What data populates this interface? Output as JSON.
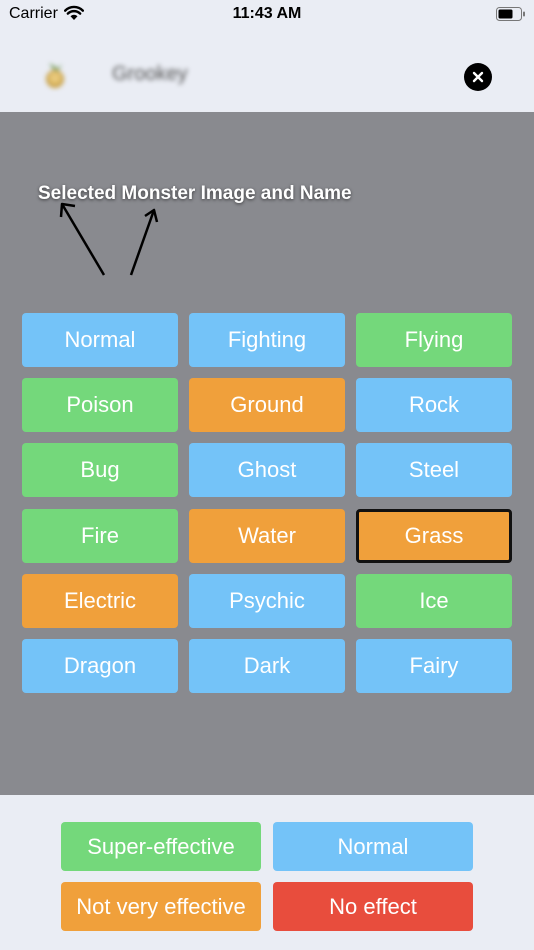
{
  "status_bar": {
    "carrier": "Carrier",
    "time": "11:43 AM"
  },
  "header": {
    "monster_name": "Grookey",
    "close_icon": "close-icon"
  },
  "annotation": "Selected Monster Image and Name",
  "colors": {
    "blue": "#74c3f8",
    "green": "#74d87b",
    "orange": "#f0a03b",
    "red": "#e84d3d",
    "overlay": "#898a8f"
  },
  "types": [
    {
      "label": "Normal",
      "color": "blue"
    },
    {
      "label": "Fighting",
      "color": "blue"
    },
    {
      "label": "Flying",
      "color": "green"
    },
    {
      "label": "Poison",
      "color": "green"
    },
    {
      "label": "Ground",
      "color": "orange"
    },
    {
      "label": "Rock",
      "color": "blue"
    },
    {
      "label": "Bug",
      "color": "green"
    },
    {
      "label": "Ghost",
      "color": "blue"
    },
    {
      "label": "Steel",
      "color": "blue"
    },
    {
      "label": "Fire",
      "color": "green"
    },
    {
      "label": "Water",
      "color": "orange"
    },
    {
      "label": "Grass",
      "color": "orange",
      "selected": true
    },
    {
      "label": "Electric",
      "color": "orange"
    },
    {
      "label": "Psychic",
      "color": "blue"
    },
    {
      "label": "Ice",
      "color": "green"
    },
    {
      "label": "Dragon",
      "color": "blue"
    },
    {
      "label": "Dark",
      "color": "blue"
    },
    {
      "label": "Fairy",
      "color": "blue"
    }
  ],
  "legend": [
    {
      "label": "Super-effective",
      "color": "green"
    },
    {
      "label": "Normal",
      "color": "blue"
    },
    {
      "label": "Not very effective",
      "color": "orange"
    },
    {
      "label": "No effect",
      "color": "red"
    }
  ]
}
